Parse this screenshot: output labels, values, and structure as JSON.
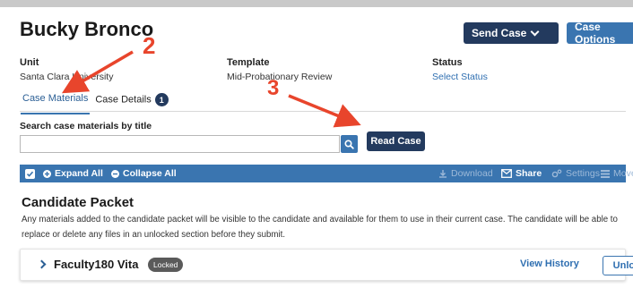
{
  "header": {
    "title": "Bucky Bronco",
    "send_case_label": "Send Case",
    "case_options_label": "Case Options"
  },
  "meta": {
    "unit_label": "Unit",
    "unit_value": "Santa Clara University",
    "template_label": "Template",
    "template_value": "Mid-Probationary Review",
    "status_label": "Status",
    "status_value": "Select Status"
  },
  "tabs": [
    {
      "label": "Case Materials",
      "active": true
    },
    {
      "label": "Case Details",
      "badge": "1"
    }
  ],
  "search": {
    "label": "Search case materials by title",
    "value": "",
    "placeholder": "",
    "read_case_label": "Read Case"
  },
  "toolbar": {
    "expand_all": "Expand All",
    "collapse_all": "Collapse All",
    "download": "Download",
    "share": "Share",
    "settings": "Settings",
    "move": "Move"
  },
  "section": {
    "title": "Candidate Packet",
    "description": "Any materials added to the candidate packet will be visible to the candidate and available for them to use in their current case. The candidate will be able to replace or delete any files in an unlocked section before they submit."
  },
  "card": {
    "title": "Faculty180 Vita",
    "status_badge": "Locked",
    "view_history": "View History",
    "unlock": "Unlock"
  },
  "annotations": {
    "two": "2",
    "three": "3",
    "color": "#e8452c"
  },
  "colors": {
    "navy": "#233a5e",
    "accent": "#3a75b0",
    "link": "#2f6fb1"
  }
}
